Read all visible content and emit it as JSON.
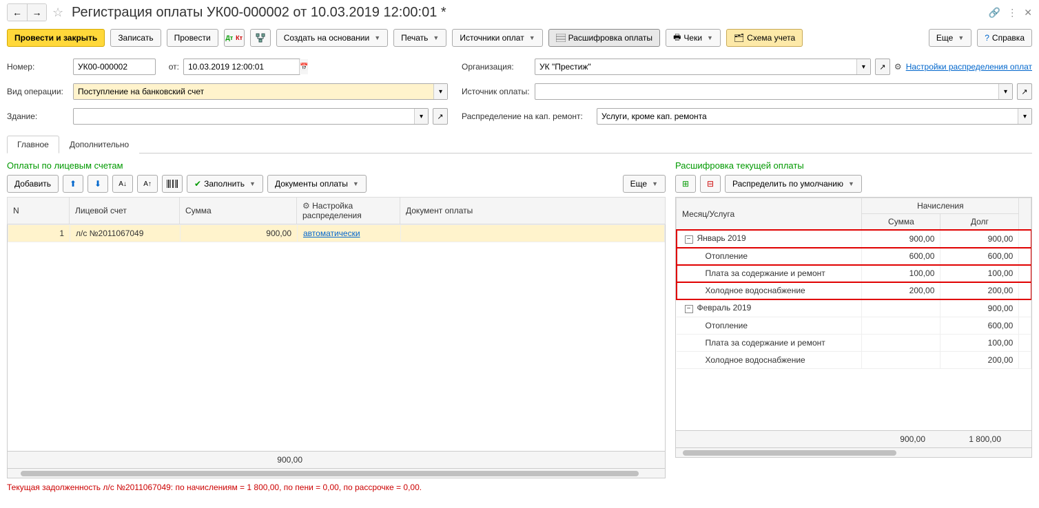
{
  "titlebar": {
    "title": "Регистрация оплаты УК00-000002 от 10.03.2019 12:00:01 *"
  },
  "toolbar": {
    "post_close": "Провести и закрыть",
    "save": "Записать",
    "post": "Провести",
    "create_based": "Создать на основании",
    "print": "Печать",
    "pay_sources": "Источники оплат",
    "breakdown": "Расшифровка оплаты",
    "checks": "Чеки",
    "scheme": "Схема учета",
    "more": "Еще",
    "help": "Справка"
  },
  "form": {
    "number_label": "Номер:",
    "number_value": "УК00-000002",
    "from_label": "от:",
    "date_value": "10.03.2019 12:00:01",
    "org_label": "Организация:",
    "org_value": "УК \"Престиж\"",
    "settings_link": "Настройки распределения оплат",
    "optype_label": "Вид операции:",
    "optype_value": "Поступление на банковский счет",
    "source_label": "Источник оплаты:",
    "building_label": "Здание:",
    "capdist_label": "Распределение на кап. ремонт:",
    "capdist_value": "Услуги, кроме кап. ремонта"
  },
  "tabs": {
    "main": "Главное",
    "extra": "Дополнительно"
  },
  "left_panel": {
    "title": "Оплаты по лицевым счетам",
    "add": "Добавить",
    "fill": "Заполнить",
    "paydocs": "Документы оплаты",
    "more": "Еще",
    "cols": {
      "n": "N",
      "acct": "Лицевой счет",
      "sum": "Сумма",
      "dist": "Настройка распределения",
      "doc": "Документ оплаты"
    },
    "rows": [
      {
        "n": "1",
        "acct": "л/с №2011067049",
        "sum": "900,00",
        "dist": "автоматически",
        "doc": ""
      }
    ],
    "footer_sum": "900,00"
  },
  "right_panel": {
    "title": "Расшифровка текущей оплаты",
    "distribute": "Распределить по умолчанию",
    "cols": {
      "month": "Месяц/Услуга",
      "accruals": "Начисления",
      "sum": "Сумма",
      "debt": "Долг"
    },
    "rows": [
      {
        "label": "Январь 2019",
        "sum": "900,00",
        "debt": "900,00",
        "level": 0,
        "hl": true,
        "exp": true
      },
      {
        "label": "Отопление",
        "sum": "600,00",
        "debt": "600,00",
        "level": 1,
        "hl": true
      },
      {
        "label": "Плата за содержание и ремонт",
        "sum": "100,00",
        "debt": "100,00",
        "level": 1,
        "hl": true
      },
      {
        "label": "Холодное водоснабжение",
        "sum": "200,00",
        "debt": "200,00",
        "level": 1,
        "hl": true
      },
      {
        "label": "Февраль 2019",
        "sum": "",
        "debt": "900,00",
        "level": 0,
        "hl": false,
        "exp": true
      },
      {
        "label": "Отопление",
        "sum": "",
        "debt": "600,00",
        "level": 1,
        "hl": false
      },
      {
        "label": "Плата за содержание и ремонт",
        "sum": "",
        "debt": "100,00",
        "level": 1,
        "hl": false
      },
      {
        "label": "Холодное водоснабжение",
        "sum": "",
        "debt": "200,00",
        "level": 1,
        "hl": false
      }
    ],
    "footer_sum": "900,00",
    "footer_debt": "1 800,00"
  },
  "bottom": "Текущая задолженность л/с №2011067049: по начислениям = 1 800,00, по пени = 0,00, по рассрочке = 0,00."
}
